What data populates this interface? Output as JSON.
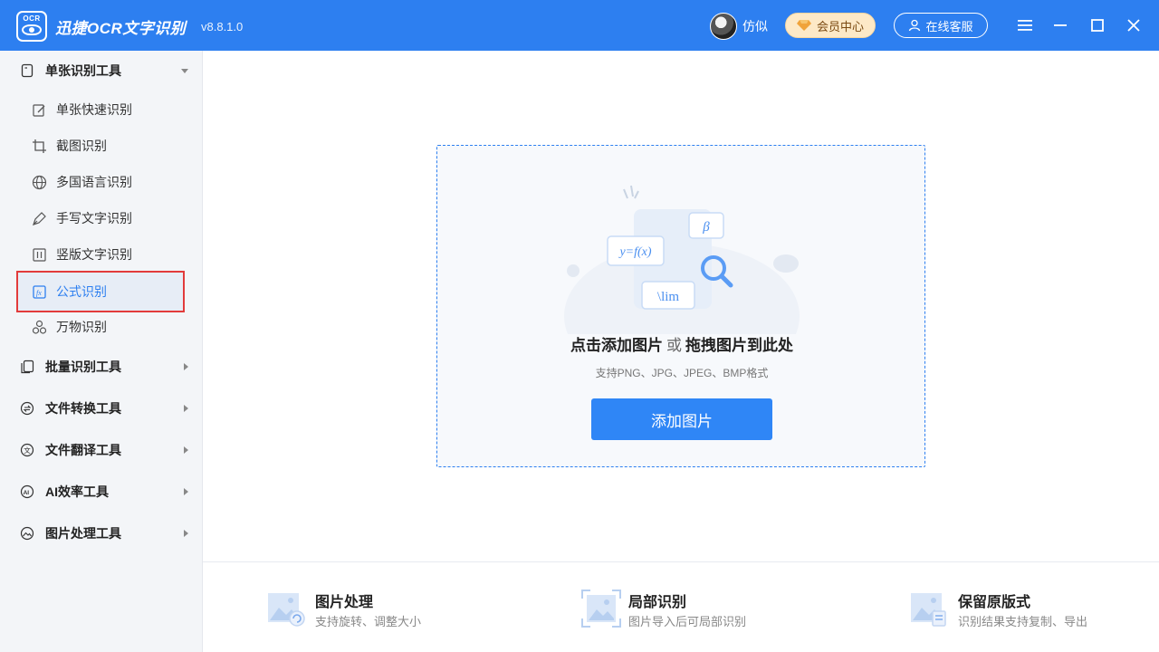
{
  "titlebar": {
    "logo_text": "OCR",
    "app_name": "迅捷OCR文字识别",
    "version": "v8.8.1.0",
    "user_name": "仿似",
    "vip_label": "会员中心",
    "service_label": "在线客服"
  },
  "sidebar": {
    "groups": [
      {
        "label": "单张识别工具",
        "icon": "single-doc-icon",
        "expanded": true
      },
      {
        "label": "批量识别工具",
        "icon": "batch-doc-icon",
        "expanded": false
      },
      {
        "label": "文件转换工具",
        "icon": "convert-icon",
        "expanded": false
      },
      {
        "label": "文件翻译工具",
        "icon": "translate-icon",
        "expanded": false
      },
      {
        "label": "AI效率工具",
        "icon": "ai-icon",
        "expanded": false
      },
      {
        "label": "图片处理工具",
        "icon": "image-process-icon",
        "expanded": false
      }
    ],
    "items": [
      {
        "label": "单张快速识别",
        "icon": "quick-scan-icon"
      },
      {
        "label": "截图识别",
        "icon": "crop-icon"
      },
      {
        "label": "多国语言识别",
        "icon": "globe-icon"
      },
      {
        "label": "手写文字识别",
        "icon": "pen-icon"
      },
      {
        "label": "竖版文字识别",
        "icon": "vertical-text-icon"
      },
      {
        "label": "公式识别",
        "icon": "formula-icon",
        "active": true
      },
      {
        "label": "万物识别",
        "icon": "objects-icon"
      }
    ]
  },
  "dropzone": {
    "action_click": "点击添加图片",
    "or": "或",
    "action_drag": "拖拽图片到此处",
    "formats": "支持PNG、JPG、JPEG、BMP格式",
    "button": "添加图片",
    "illus_formula1": "y=f(x)",
    "illus_formula2": "β",
    "illus_formula3": "\\lim"
  },
  "features": [
    {
      "title": "图片处理",
      "desc": "支持旋转、调整大小"
    },
    {
      "title": "局部识别",
      "desc": "图片导入后可局部识别"
    },
    {
      "title": "保留原版式",
      "desc": "识别结果支持复制、导出"
    }
  ],
  "colors": {
    "accent": "#2d7ff0",
    "active_border": "#e23b3b",
    "vip_bg": "#fde9c7"
  }
}
